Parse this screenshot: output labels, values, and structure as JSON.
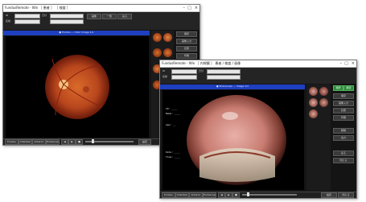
{
  "back_window": {
    "title": "FundusRemote - Win  ［ 患者 ］ ［ 検査 ］",
    "fields": [
      {
        "label": "ID"
      },
      {
        "label": "名前"
      },
      {
        "label": "日付"
      }
    ],
    "top_buttons": [
      "画像",
      "一覧",
      "戻る"
    ],
    "blue_bar": "● Fundus — Color Image 1/1",
    "side_buttons": [
      "保存",
      "画像入力",
      "比較",
      "印刷"
    ],
    "bottom_tabs": [
      "Fundus",
      "Chamber",
      "Anterior",
      "Endoscope"
    ],
    "bottom_controls": [
      "◀",
      "▶",
      "■"
    ],
    "bottom_right": [
      "設定",
      "閉じる"
    ]
  },
  "front_window": {
    "title": "FundusRemote - Win  ［ 内視鏡 ］ 患者 / 検査 / 画像",
    "fields": [
      {
        "label": "ID"
      },
      {
        "label": "名前"
      },
      {
        "label": "日付"
      }
    ],
    "blue_bar": "● Endoscope — Image 1/1",
    "side_buttons": [
      "保存",
      "画像入力",
      "比較",
      "印刷",
      "削除",
      "出力",
      "戻る",
      "閉じる"
    ],
    "green_buttons": [
      "選択",
      "確定"
    ],
    "overlay_text": [
      "ID: ____",
      "Name: ____",
      "Age: __",
      "Date: ____",
      "Time: ____"
    ],
    "bottom_tabs": [
      "Fundus",
      "Chamber",
      "Anterior",
      "Endoscope"
    ],
    "bottom_controls": [
      "◀",
      "▶",
      "■"
    ],
    "bottom_right": [
      "設定",
      "閉じる"
    ]
  },
  "colors": {
    "window_bg": "#141414",
    "accent_blue": "#1e3fbf",
    "green": "#2e8b3a"
  }
}
